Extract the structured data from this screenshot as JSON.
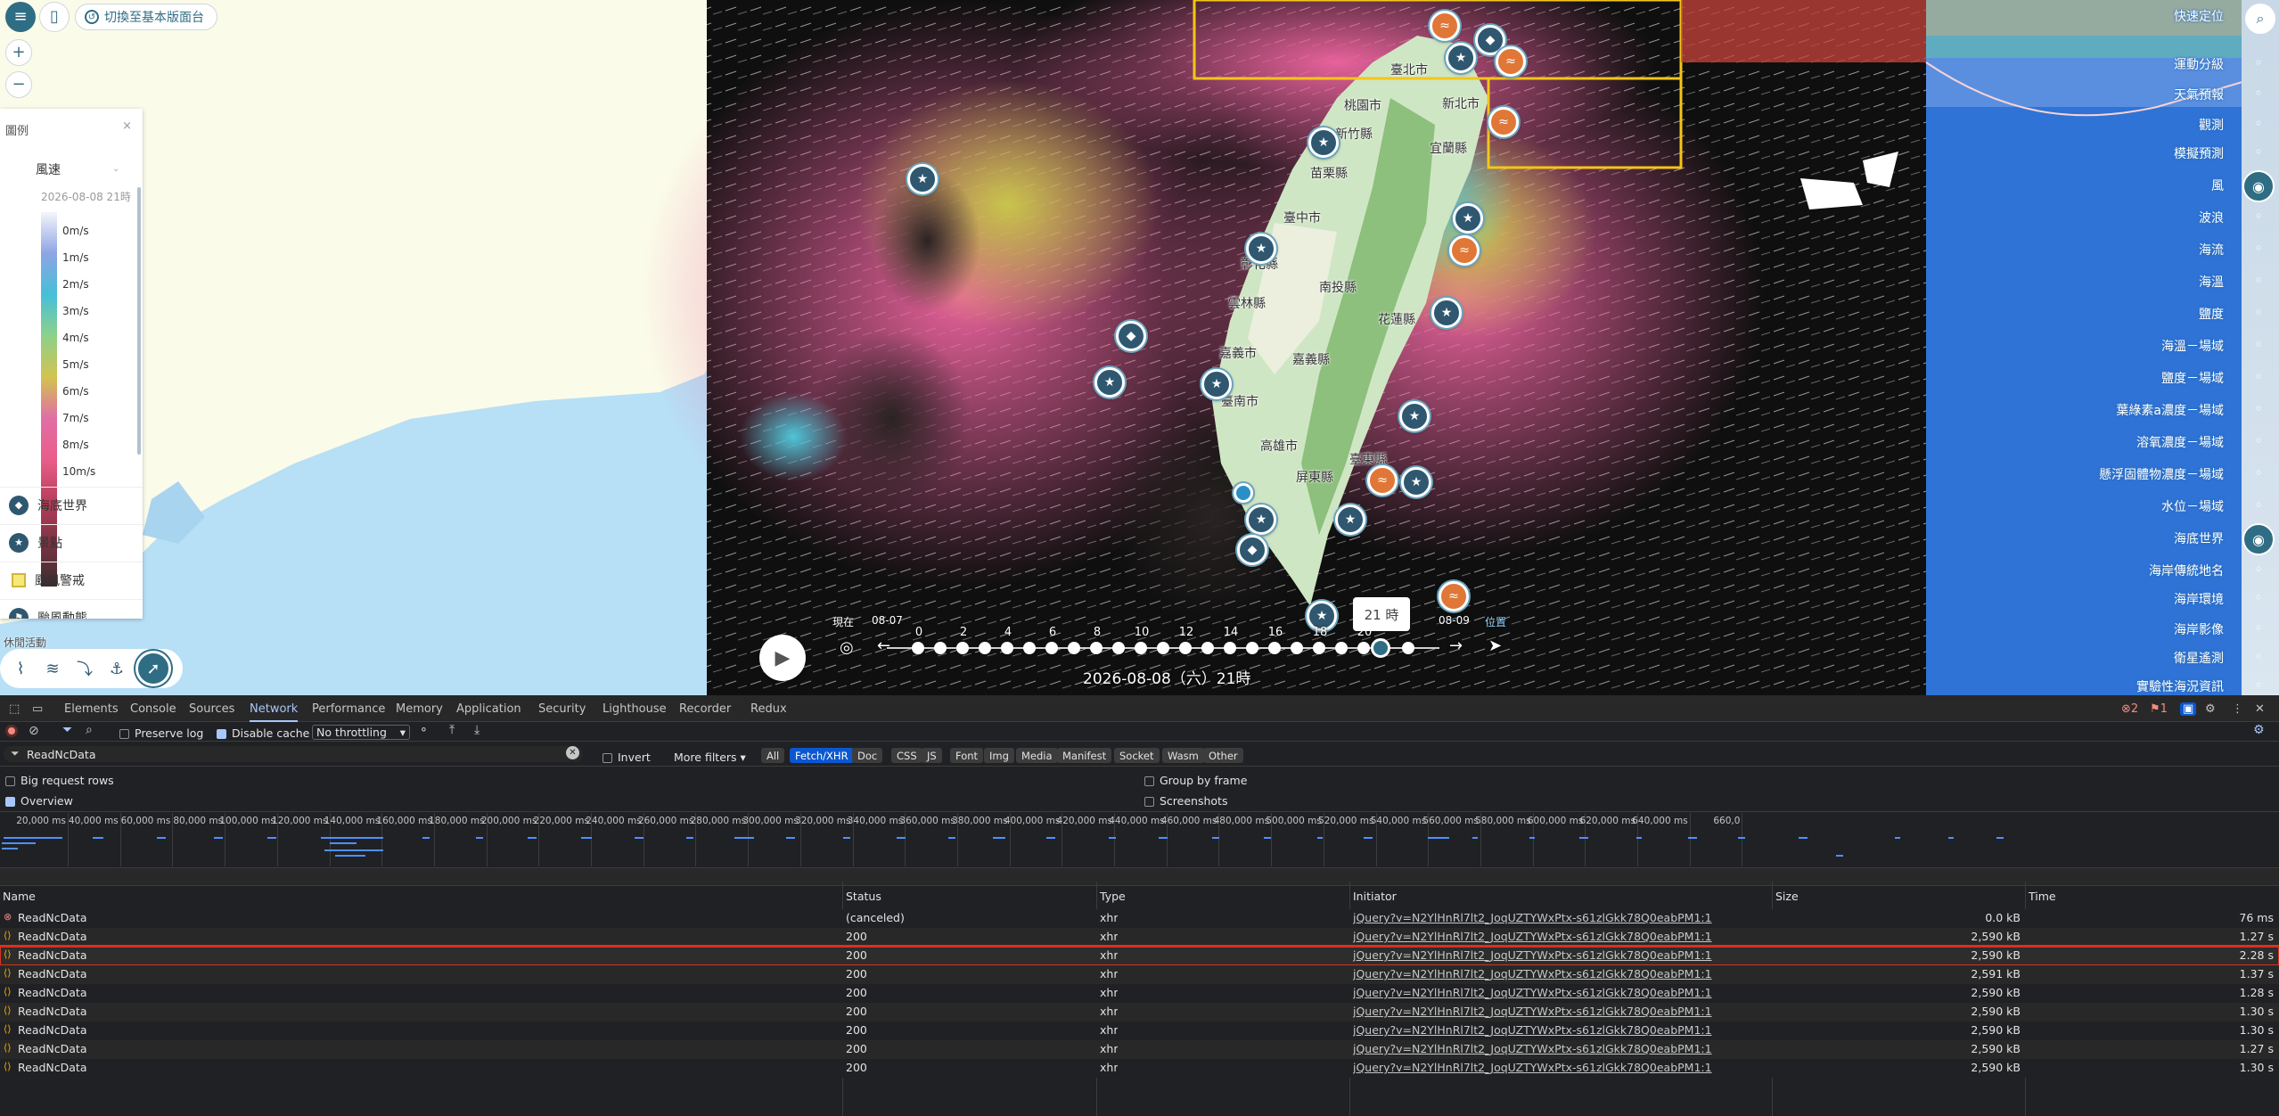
{
  "map": {
    "switch_basic": "切換至基本版面台",
    "zoom_in": "+",
    "zoom_out": "−",
    "legend": {
      "title": "圖例",
      "close": "×",
      "layer_name": "風速",
      "date": "2026-08-08 21時",
      "ticks": [
        "0m/s",
        "1m/s",
        "2m/s",
        "3m/s",
        "4m/s",
        "5m/s",
        "6m/s",
        "7m/s",
        "8m/s",
        "10m/s"
      ],
      "items": [
        {
          "label": "海底世界",
          "icon": "fish-icon"
        },
        {
          "label": "景點",
          "icon": "star-icon"
        },
        {
          "label": "颱風警戒",
          "icon": "warning-square-icon"
        },
        {
          "label": "颱風動態",
          "icon": "typhoon-icon"
        }
      ]
    },
    "activity_label": "休閒活動",
    "activities": [
      "surfing-icon",
      "swimming-icon",
      "diving-icon",
      "rowing-icon",
      "running-icon"
    ],
    "right_menu": [
      "快速定位",
      "運動分級",
      "天氣預報",
      "觀測",
      "模擬預測",
      "風",
      "波浪",
      "海流",
      "海溫",
      "鹽度",
      "海溫－場域",
      "鹽度－場域",
      "葉綠素a濃度－場域",
      "溶氧濃度－場域",
      "懸浮固體物濃度－場域",
      "水位－場域",
      "海底世界",
      "海岸傳統地名",
      "海岸環境",
      "海岸影像",
      "衛星遙測",
      "實驗性海況資訊"
    ],
    "places": [
      "臺北市",
      "新北市",
      "桃園市",
      "新竹縣",
      "宜蘭縣",
      "苗栗縣",
      "臺中市",
      "彰化縣",
      "南投縣",
      "雲林縣",
      "嘉義市",
      "嘉義縣",
      "花蓮縣",
      "臺南市",
      "高雄市",
      "屏東縣",
      "臺東縣"
    ],
    "timeline": {
      "now_label": "現在",
      "start_date": "08-07",
      "end_date": "08-09",
      "locate": "位置",
      "hours": [
        "0",
        "2",
        "4",
        "6",
        "8",
        "10",
        "12",
        "14",
        "16",
        "18",
        "20"
      ],
      "tooltip": "21 時",
      "current": "2026-08-08（六）21時"
    }
  },
  "devtools": {
    "tabs": [
      "Elements",
      "Console",
      "Sources",
      "Network",
      "Performance",
      "Memory",
      "Application",
      "Security",
      "Lighthouse",
      "Recorder",
      "Redux"
    ],
    "active_tab": "Network",
    "errors": "2",
    "warnings": "1",
    "preserve_log": "Preserve log",
    "disable_cache": "Disable cache",
    "throttling": "No throttling",
    "filter_value": "ReadNcData",
    "invert": "Invert",
    "more_filters": "More filters",
    "type_filters": [
      "All",
      "Fetch/XHR",
      "Doc",
      "CSS",
      "JS",
      "Font",
      "Img",
      "Media",
      "Manifest",
      "Socket",
      "Wasm",
      "Other"
    ],
    "active_type": "Fetch/XHR",
    "big_rows": "Big request rows",
    "overview": "Overview",
    "group_by_frame": "Group by frame",
    "screenshots": "Screenshots",
    "overview_ticks": [
      "20,000 ms",
      "40,000 ms",
      "60,000 ms",
      "80,000 ms",
      "100,000 ms",
      "120,000 ms",
      "140,000 ms",
      "160,000 ms",
      "180,000 ms",
      "200,000 ms",
      "220,000 ms",
      "240,000 ms",
      "260,000 ms",
      "280,000 ms",
      "300,000 ms",
      "320,000 ms",
      "340,000 ms",
      "360,000 ms",
      "380,000 ms",
      "400,000 ms",
      "420,000 ms",
      "440,000 ms",
      "460,000 ms",
      "480,000 ms",
      "500,000 ms",
      "520,000 ms",
      "540,000 ms",
      "560,000 ms",
      "580,000 ms",
      "600,000 ms",
      "620,000 ms",
      "640,000 ms",
      "660,0"
    ],
    "columns": [
      "Name",
      "Status",
      "Type",
      "Initiator",
      "Size",
      "Time"
    ],
    "rows": [
      {
        "name": "ReadNcData",
        "status": "(canceled)",
        "type": "xhr",
        "initiator": "jQuery?v=N2YlHnRl7lt2_JoqUZTYWxPtx-s61zlGkk78Q0eabPM1:1",
        "size": "0.0 kB",
        "time": "76 ms",
        "error": true
      },
      {
        "name": "ReadNcData",
        "status": "200",
        "type": "xhr",
        "initiator": "jQuery?v=N2YlHnRl7lt2_JoqUZTYWxPtx-s61zlGkk78Q0eabPM1:1",
        "size": "2,590 kB",
        "time": "1.27 s"
      },
      {
        "name": "ReadNcData",
        "status": "200",
        "type": "xhr",
        "initiator": "jQuery?v=N2YlHnRl7lt2_JoqUZTYWxPtx-s61zlGkk78Q0eabPM1:1",
        "size": "2,590 kB",
        "time": "2.28 s",
        "highlight": true
      },
      {
        "name": "ReadNcData",
        "status": "200",
        "type": "xhr",
        "initiator": "jQuery?v=N2YlHnRl7lt2_JoqUZTYWxPtx-s61zlGkk78Q0eabPM1:1",
        "size": "2,591 kB",
        "time": "1.37 s"
      },
      {
        "name": "ReadNcData",
        "status": "200",
        "type": "xhr",
        "initiator": "jQuery?v=N2YlHnRl7lt2_JoqUZTYWxPtx-s61zlGkk78Q0eabPM1:1",
        "size": "2,590 kB",
        "time": "1.28 s"
      },
      {
        "name": "ReadNcData",
        "status": "200",
        "type": "xhr",
        "initiator": "jQuery?v=N2YlHnRl7lt2_JoqUZTYWxPtx-s61zlGkk78Q0eabPM1:1",
        "size": "2,590 kB",
        "time": "1.30 s"
      },
      {
        "name": "ReadNcData",
        "status": "200",
        "type": "xhr",
        "initiator": "jQuery?v=N2YlHnRl7lt2_JoqUZTYWxPtx-s61zlGkk78Q0eabPM1:1",
        "size": "2,590 kB",
        "time": "1.30 s"
      },
      {
        "name": "ReadNcData",
        "status": "200",
        "type": "xhr",
        "initiator": "jQuery?v=N2YlHnRl7lt2_JoqUZTYWxPtx-s61zlGkk78Q0eabPM1:1",
        "size": "2,590 kB",
        "time": "1.27 s"
      },
      {
        "name": "ReadNcData",
        "status": "200",
        "type": "xhr",
        "initiator": "jQuery?v=N2YlHnRl7lt2_JoqUZTYWxPtx-s61zlGkk78Q0eabPM1:1",
        "size": "2,590 kB",
        "time": "1.30 s"
      }
    ]
  }
}
